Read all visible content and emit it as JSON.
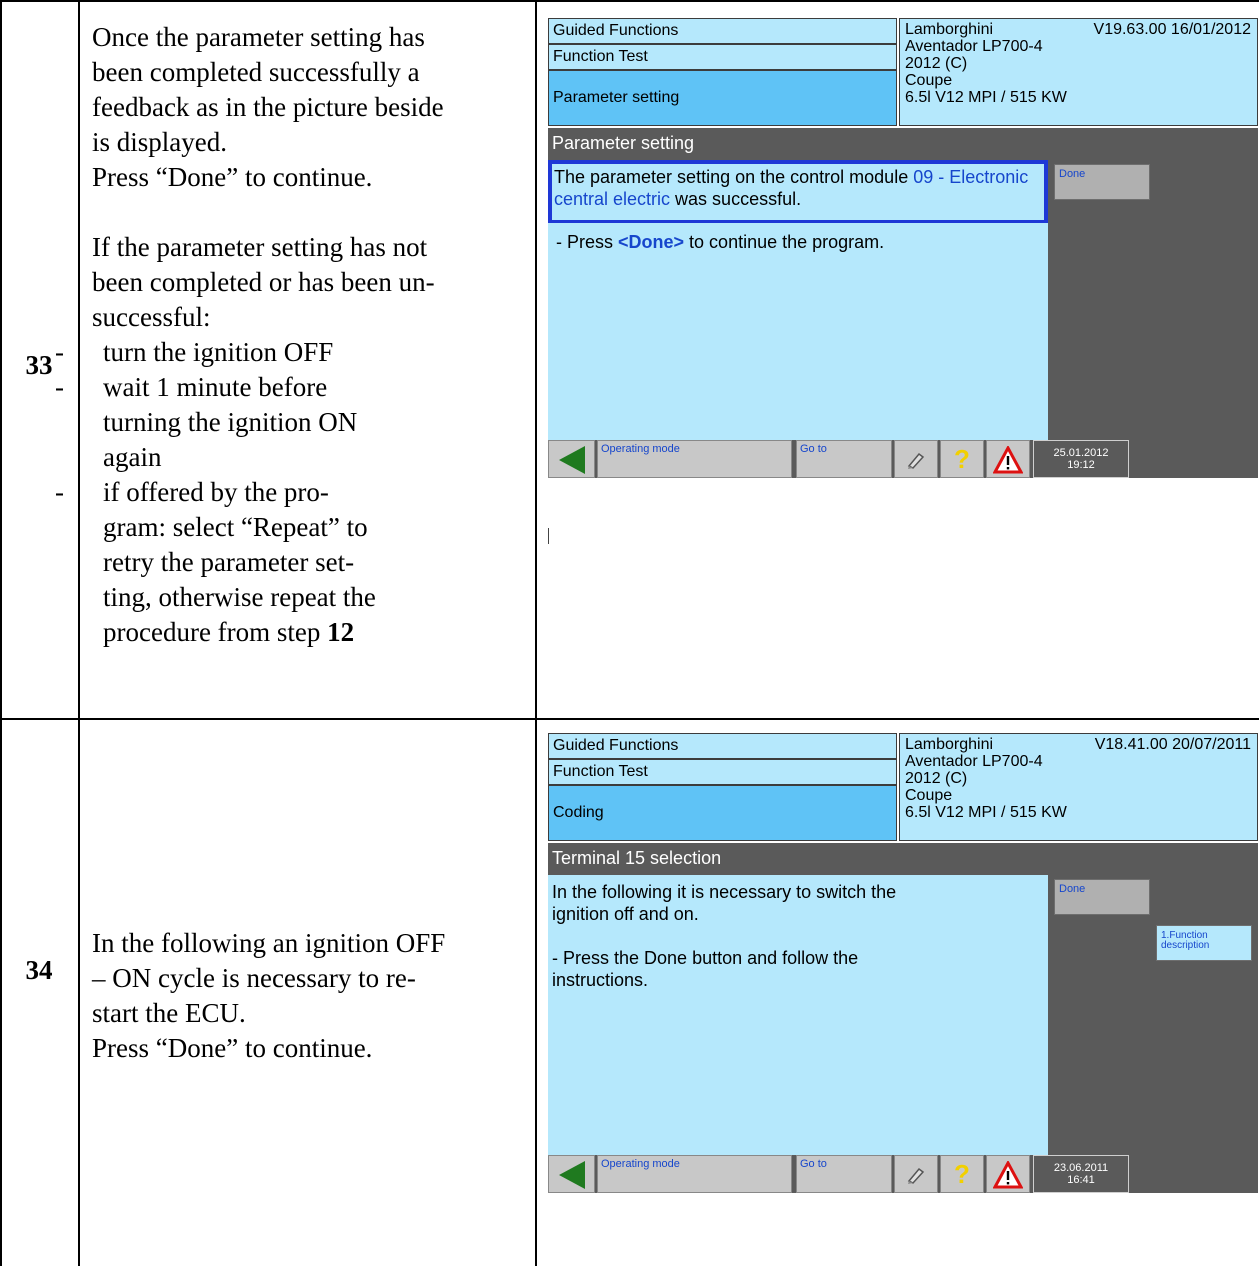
{
  "rows": [
    {
      "step": "33",
      "text": {
        "intro": [
          "Once the parameter setting has",
          "been completed successfully a",
          "feedback as in the picture beside",
          "is displayed."
        ],
        "press": "Press “Done” to continue.",
        "fail_intro": [
          "If the parameter setting has not",
          "been completed or has been un-",
          "successful:"
        ],
        "bullet_dash": "-",
        "bullets": [
          [
            "turn the ignition OFF"
          ],
          [
            "wait 1 minute before",
            "turning the ignition ON",
            "again"
          ],
          [
            "if offered by the pro-",
            "gram: select “Repeat” to",
            "retry the parameter set-",
            "ting, otherwise repeat the",
            "procedure from step"
          ]
        ],
        "step_ref": "12"
      },
      "screen": {
        "header": [
          "Guided Functions",
          "Function Test",
          "Parameter setting"
        ],
        "vehicle": {
          "make": "Lamborghini",
          "version": "V19.63.00 16/01/2012",
          "model": "Aventador LP700-4",
          "year": "2012 (C)",
          "body": "Coupe",
          "engine": "6.5l V12 MPI / 515 KW"
        },
        "title": "Parameter setting",
        "message": {
          "part1": "The parameter setting on the control module ",
          "module": "09 - Electronic central electric",
          "part2": "  was successful.",
          "press_prefix": "- Press ",
          "press_key": "<Done>",
          "press_suffix": " to continue the program."
        },
        "done_button": "Done",
        "bottom": {
          "operating_mode": "Operating mode",
          "go_to": "Go to",
          "date": "25.01.2012",
          "time": "19:12"
        }
      }
    },
    {
      "step": "34",
      "text": {
        "lines": [
          "In the following an ignition OFF",
          "– ON cycle is necessary to re-",
          "start the ECU.",
          "Press “Done” to continue."
        ]
      },
      "screen": {
        "header": [
          "Guided Functions",
          "Function Test",
          "Coding"
        ],
        "vehicle": {
          "make": "Lamborghini",
          "version": "V18.41.00 20/07/2011",
          "model": "Aventador LP700-4",
          "year": "2012 (C)",
          "body": "Coupe",
          "engine": "6.5l V12 MPI / 515 KW"
        },
        "title": "Terminal 15 selection",
        "message": {
          "line1": "In the following it is necessary to switch the",
          "line2": "ignition off and on.",
          "line3": "- Press the Done button and follow the",
          "line4": "instructions."
        },
        "done_button": "Done",
        "func_button": [
          "1.Function",
          "description"
        ],
        "bottom": {
          "operating_mode": "Operating mode",
          "go_to": "Go to",
          "date": "23.06.2011",
          "time": "16:41"
        }
      }
    }
  ],
  "icons": [
    "back-arrow-icon",
    "print-icon",
    "help-icon",
    "warning-icon"
  ]
}
